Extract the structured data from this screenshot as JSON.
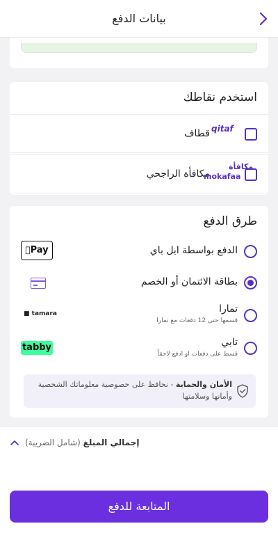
{
  "header": {
    "title": "بيانات الدفع",
    "back_icon": "chevron-right-icon"
  },
  "points": {
    "title": "استخدم نقاطك",
    "options": [
      {
        "label": "قطاف",
        "logo": "qitaf"
      },
      {
        "label": "مكافأة الراجحي",
        "logo_ar": "مكافأة",
        "logo_en": "mokafaa"
      }
    ]
  },
  "payment": {
    "title": "طرق الدفع",
    "methods": [
      {
        "label": "الدفع بواسطة ابل باي",
        "sublabel": "",
        "logo": "Pay",
        "selected": false
      },
      {
        "label": "بطاقة الائتمان أو الخصم",
        "sublabel": "",
        "logo": "card-icon",
        "selected": true
      },
      {
        "label": "تمارا",
        "sublabel": "قسمها حتى 12 دفعات مع تمارا",
        "logo": "tamara",
        "selected": false
      },
      {
        "label": "تابي",
        "sublabel": "قسط على دفعات او ادفع لاحقاً",
        "logo": "tabby",
        "selected": false
      }
    ],
    "security": {
      "bold": "الأمان والحماية",
      "text": " - نحافظ على خصوصية معلوماتك الشخصية وأمانها وسلامتها"
    }
  },
  "footer": {
    "total_label": "إجمالي المبلغ",
    "tax_note": "(شامل الضريبة)",
    "cta": "المتابعة للدفع"
  },
  "colors": {
    "accent": "#6b2fe0",
    "tabby": "#3bff9d"
  }
}
